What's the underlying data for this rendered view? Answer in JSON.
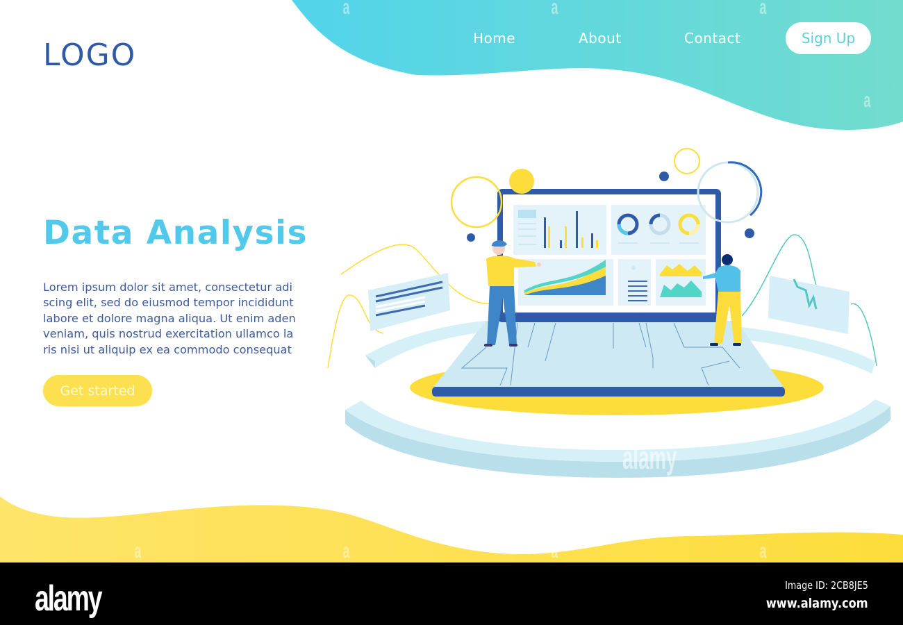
{
  "header": {
    "logo": "LOGO",
    "nav": [
      {
        "label": "Home"
      },
      {
        "label": "About"
      },
      {
        "label": "Contact"
      }
    ],
    "signup_label": "Sign Up"
  },
  "hero": {
    "title": "Data Analysis",
    "body_lines": [
      "Lorem ipsum dolor sit amet, consectetur adi",
      "scing elit, sed do eiusmod tempor incididunt",
      "labore et dolore magna aliqua. Ut enim aden",
      "veniam, quis nostrud exercitation ullamco la",
      "ris nisi ut aliquip ex ea commodo consequat"
    ],
    "cta_label": "Get started"
  },
  "illustration": {
    "description": "Two people analyzing dashboard on large laptop screen",
    "icons": [
      "bar-chart-icon",
      "donut-chart-icon",
      "area-chart-icon",
      "list-icon",
      "person-icon"
    ]
  },
  "colors": {
    "brand_blue": "#2f5aa8",
    "accent_cyan": "#52c8ea",
    "accent_teal": "#6ddbd0",
    "accent_yellow": "#fde050",
    "text_blue": "#3d5a9a"
  },
  "footer": {
    "brand": "alamy",
    "image_id": "Image ID: 2CB8JE5",
    "url": "www.alamy.com",
    "watermark": "a",
    "watermark_center": "alamy"
  }
}
